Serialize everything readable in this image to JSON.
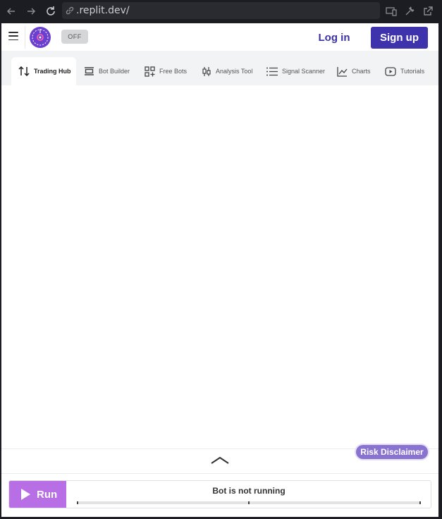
{
  "browser": {
    "url": ".replit.dev/"
  },
  "header": {
    "toggle_label": "OFF",
    "login_label": "Log in",
    "signup_label": "Sign up"
  },
  "tabs": [
    {
      "label": "Trading Hub",
      "icon": "swap-arrows-icon",
      "active": true
    },
    {
      "label": "Bot Builder",
      "icon": "bot-builder-icon",
      "active": false
    },
    {
      "label": "Free Bots",
      "icon": "grid-plus-icon",
      "active": false
    },
    {
      "label": "Analysis Tool",
      "icon": "candlestick-icon",
      "active": false
    },
    {
      "label": "Signal Scanner",
      "icon": "list-icon",
      "active": false
    },
    {
      "label": "Charts",
      "icon": "line-chart-icon",
      "active": false
    },
    {
      "label": "Tutorials",
      "icon": "video-icon",
      "active": false
    }
  ],
  "footer": {
    "risk_disclaimer": "Risk Disclaimer",
    "run_label": "Run",
    "status": "Bot is not running"
  },
  "colors": {
    "brand": "#3f33ad",
    "run": "#b86fe5",
    "disclaimer": "#8a72d1"
  }
}
